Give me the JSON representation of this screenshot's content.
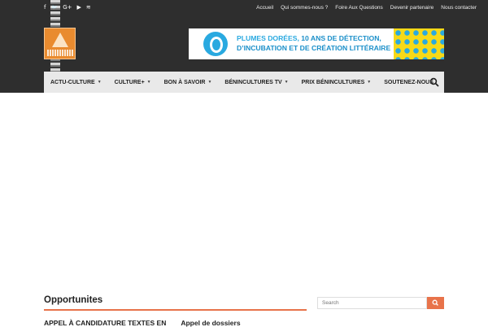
{
  "header": {
    "social_icons": [
      "facebook-icon",
      "twitter-icon",
      "google-plus-icon",
      "youtube-icon",
      "rss-icon"
    ],
    "social_glyphs": [
      "f",
      "🐦",
      "G+",
      "▶",
      "≋"
    ],
    "top_links": [
      "Accueil",
      "Qui sommes-nous ?",
      "Foire Aux Questions",
      "Devenir partenaire",
      "Nous contacter"
    ],
    "banner": {
      "line1_highlight": "PLUMES DORÉES,",
      "line1_rest": " 10 ANS DE DÉTECTION,",
      "line2": "D’INCUBATION ET DE CRÉATION LITTÉRAIRE"
    }
  },
  "nav": {
    "items": [
      {
        "label": "ACTU-CULTURE",
        "has_dropdown": true
      },
      {
        "label": "CULTURE+",
        "has_dropdown": true
      },
      {
        "label": "BON À SAVOIR",
        "has_dropdown": true
      },
      {
        "label": "BÉNINCULTURES TV",
        "has_dropdown": true
      },
      {
        "label": "PRIX BÉNINCULTURES",
        "has_dropdown": true
      },
      {
        "label": "SOUTENEZ-NOUS",
        "has_dropdown": false
      }
    ],
    "search_icon": "search-icon"
  },
  "main": {
    "section_title": "Opportunites",
    "posts": [
      "APPEL À CANDIDATURE TEXTES EN",
      "Appel de dossiers"
    ]
  },
  "sidebar": {
    "search_placeholder": "Search",
    "search_button_icon": "search-icon"
  },
  "colors": {
    "header_bg": "#2e2e2e",
    "nav_bg": "#e9e9e9",
    "accent": "#e8734a",
    "logo_orange": "#e98b2f",
    "banner_blue": "#29a9e0",
    "banner_yellow": "#f7d917"
  }
}
